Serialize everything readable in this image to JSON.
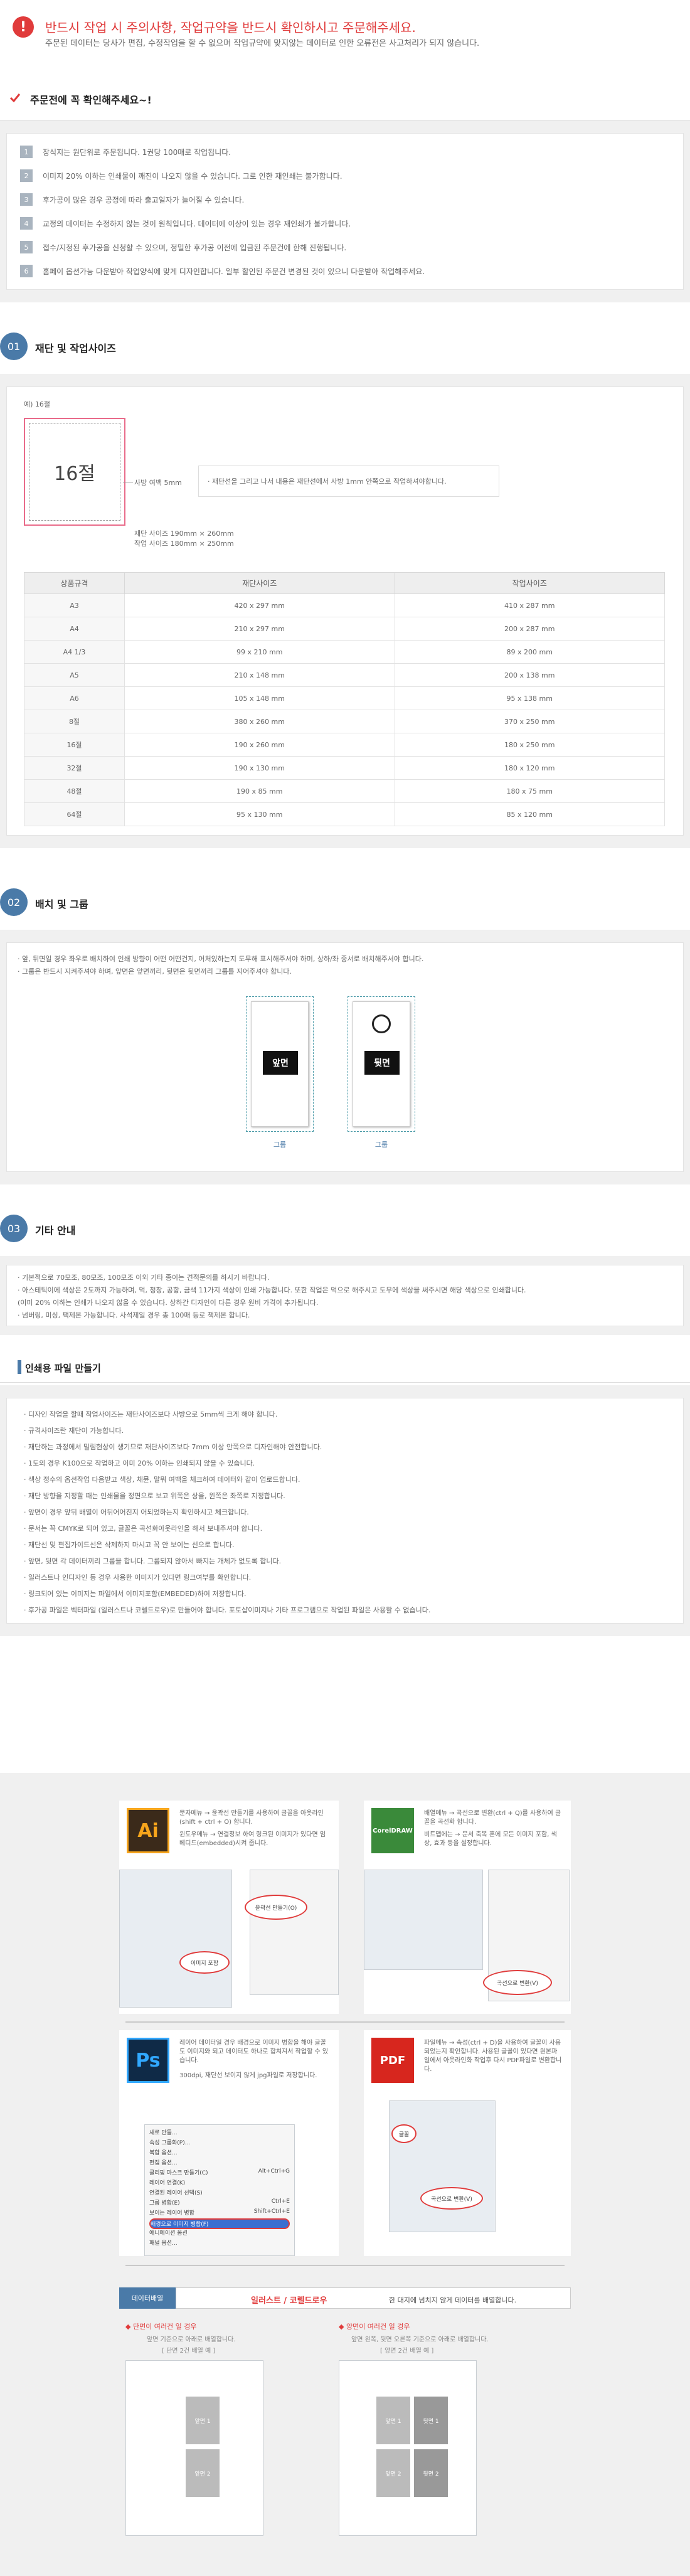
{
  "notice": {
    "title": "반드시 작업 시 주의사항, 작업규약을 반드시 확인하시고 주문해주세요.",
    "subtitle": "주문된 데이터는 당사가 편집, 수정작업을 할 수 없으며 작업규약에 맞지않는 데이터로 인한 오류전은 사고처리가 되지 않습니다."
  },
  "check": {
    "title": "주문전에 꼭 확인해주세요~!",
    "items": [
      "장식지는 원단위로 주문됩니다. 1권당 100매로 작업됩니다.",
      "이미지 20% 이하는 인쇄물이 깨진이 나오지 않을 수 있습니다. 그로 인한 재인쇄는 불가합니다.",
      "후가공이 많은 경우 공정에 따라 출고일자가 늘어질 수 있습니다.",
      "교정의 데이터는 수정하지 않는 것이 원칙입니다. 데이터에 이상이 있는 경우 재인쇄가 불가합니다.",
      "접수/지정된 후가공을 신청할 수 있으며, 정밀한 후가공 이전에 입금된 주문건에 한해 진행됩니다.",
      "홈페이 옵션가능 다운받아 작업양식에 맞게 디자인합니다. 일부 할인된 주문건 변경된 것이 있으니 다운받아 작업해주세요."
    ]
  },
  "section1": {
    "num": "01",
    "title": "재단 및 작업사이즈",
    "example_label": "예) 16절",
    "card_label": "16절",
    "bleed_label": "사방 여백 5mm",
    "note": "· 재단선을 그리고 나서 내용은 재단선에서 사방 1mm 안쪽으로 작업하셔야합니다.",
    "cut_size": "재단 사이즈 190mm × 260mm",
    "work_size": "작업 사이즈 180mm × 250mm",
    "table_headers": [
      "상품규격",
      "재단사이즈",
      "작업사이즈"
    ],
    "table_rows": [
      [
        "A3",
        "420 x 297 mm",
        "410 x 287 mm"
      ],
      [
        "A4",
        "210 x 297 mm",
        "200 x 287 mm"
      ],
      [
        "A4 1/3",
        "99 x 210 mm",
        "89 x 200 mm"
      ],
      [
        "A5",
        "210 x 148 mm",
        "200 x 138 mm"
      ],
      [
        "A6",
        "105 x 148 mm",
        "95 x 138 mm"
      ],
      [
        "8절",
        "380 x 260 mm",
        "370 x 250 mm"
      ],
      [
        "16절",
        "190 x 260 mm",
        "180 x 250 mm"
      ],
      [
        "32절",
        "190 x 130 mm",
        "180 x 120 mm"
      ],
      [
        "48절",
        "190 x 85 mm",
        "180 x 75 mm"
      ],
      [
        "64절",
        "95 x 130 mm",
        "85 x 120 mm"
      ]
    ]
  },
  "section2": {
    "num": "02",
    "title": "배치 및 그룹",
    "lines": [
      "· 앞, 뒤면일 경우 좌우로 배치하여 인쇄 방향이 어떤 어떤건지, 어처있하는지 도무해 표시해주셔야 하며, 상하/좌 중서로 배치해주셔야 합니다.",
      "· 그룹은 반드시 지켜주셔야 하며, 앞면은 앞면끼리, 뒷면은 뒷면끼리 그룹를 지어주셔야 합니다."
    ],
    "front_label": "앞면",
    "back_label": "뒷면",
    "group_caption_1": "그룹",
    "group_caption_2": "그룹"
  },
  "section3": {
    "num": "03",
    "title": "기타 안내",
    "lines": [
      "· 기본적으로 70모조, 80모조, 100모조 이외 기타 종이는 견적문의를 하시기 바랍니다.",
      "· 아스테틱이에 색상은 2도까지 가능하며, 먹, 청창, 공항, 금색 11가지 색상이 인쇄 가능합니다. 또한 작업은 먹으로 해주시고 도무에 색상을 써주시면 해당 색상으로 인쇄합니다.",
      "  (이미 20% 이하는 인쇄가 나오지 않을 수 있습니다. 상하간 디자인이 다른 경우 원비 가격이 추가됩니다.",
      "· 넘버링, 미싱, 팩제본 가능합니다. 사석제일 경우 총 100매 등로 책제본 합니다."
    ]
  },
  "printfile": {
    "title": "인쇄용 파일 만들기",
    "lines": [
      "· 디자인 작업을 할때 작업사이즈는 재단사이즈보다 사방으로 5mm씩 크게 해야 합니다.",
      "· 규격사이즈란 재단이 가능합니다.",
      "· 재단하는 과정에서 밀림현상이 생기므로 재단사이즈보다 7mm 이상 안쪽으로 디자인해야 안전합니다.",
      "· 1도의 경우 K100으로 작업하고 이미 20% 이하는 인쇄되지 않을 수 있습니다.",
      "· 색상 정수의 옵션작업 다음받고 색상, 채뮨, 말뭐 여백을 체크하여 데이터와 같이 업로드합니다.",
      "· 재단 방향을 지정할 때는 인쇄물을 정면으로 보고 위쪽은 상을, 윈쪽은 좌쪽로 지정합니다.",
      "· 앞면이 경우 앞뒤 배열이 어뒤어어진지 어되었하는지 확인하시고 체크합니다.",
      "· 문서는 꼭 CMYK로 되어 있고, 글꼴은 곡선화아웃라인을 해서 보내주셔야 합니다.",
      "· 재단선 및 편집가이드선은 삭제하지 마시고 꼭 안 보이는 선으로 합니다.",
      "· 앞면, 뒷면 각 데이터끼리 그룹을 합니다. 그룹되지 않아서 빠지는 개체가 없도록 합니다.",
      "· 일러스트나 인디자인 등 경우 사용한 이미지가 있다면 링크여부를 확인합니다.",
      "· 링크되어 있는 이미지는 파일에서 이미지포함(EMBEDED)하여 저장합니다.",
      "· 후가공 파일은 벡터파일 (일러스트나 코렐드로우)로 만들어야 합니다. 포토샵이미지나 기타 프로그램으로 작업된 파일은 사용할 수 없습니다."
    ]
  },
  "tutorial": {
    "ai_icon": "Ai",
    "ai_notes": [
      "문자메뉴 → 윤곽선 만들기를 사용하여 글꼴을 아웃라인(shift + ctrl + O) 합니다.",
      "윈도우메뉴 → 연결정보 하여 링크된 이미지가 있다면 임베디드(embedded)시켜 줍니다."
    ],
    "ai_callout_1": "윤곽선 만들기(O)",
    "ai_callout_2": "이미지 포함",
    "cd_icon": "CorelDRAW",
    "cd_notes": [
      "배열메뉴 → 곡선으로 변환(ctrl + Q)를 사용하여 글꼴을 곡선화 합니다.",
      "비트맵에는 → 문서 축복 혼에 모든 이미지 포함, 색상, 효과 등을 설정합니다."
    ],
    "cd_callout": "곡선으로 변환(V)",
    "ps_icon": "Ps",
    "ps_notes": [
      "레이어 데이터일 경우 배경으로 이미지 병합을 해야 글꼴도 이미지와 되고 데이터도 하나로 합쳐져서 작업할 수 있습니다.",
      "300dpi, 재단선 보이지 않게 jpg파일로 저장합니다."
    ],
    "ps_menu": [
      "새로 만들...",
      "속성 그룹화(P)...",
      "복합 옵션...",
      "편집 옵션...",
      "클리핑 마스크 만들기(C)",
      "레이어 연결(K)",
      "연결된 레이어 선택(S)",
      "그룹 병합(E)",
      "보이는 레이어 병합",
      "배경으로 이미지 병합(F)",
      "애니메이션 옵션",
      "패널 옵션..."
    ],
    "ps_shortcuts": [
      "",
      "",
      "",
      "",
      "Alt+Ctrl+G",
      "",
      "",
      "Ctrl+E",
      "Shift+Ctrl+E",
      "",
      "",
      ""
    ],
    "ps_callout": "배경으로 이미지 병합(F)",
    "pdf_icon": "PDF",
    "pdf_notes": [
      "파일메뉴 → 속성(ctrl + D)을 사용하여 글꼴이 사용 되었는지 확인합니다. 사용된 글꼴이 있다면 원본파일에서 아웃라인화 작업후 다시 PDF파일로 변환합니다."
    ],
    "pdf_callout_1": "글꼴",
    "pdf_callout_2": "곡선으로 변환(V)",
    "arrange_tab": "데이터배열",
    "arrange_title": "일러스트 / 코렐드로우",
    "arrange_desc": "한 대지에 넘치지 않게 데이터를 배열합니다.",
    "single_title": "◆ 단면이 여러건 일 경우",
    "single_sub": "앞면 기준으로 아래로 배열합니다.",
    "single_hint": "[ 단면 2건 배열 예 ]",
    "double_title": "◆ 양면이 여러건 일 경우",
    "double_sub": "앞면 왼쪽, 뒷면 오른쪽 기준으로 아래로 배열합니다.",
    "double_hint": "[ 양면 2건 배열 예 ]",
    "single_pages": [
      "앞면 1",
      "앞면 2"
    ],
    "double_pages": [
      "앞면 1",
      "뒷면 1",
      "앞면 2",
      "뒷면 2"
    ]
  }
}
